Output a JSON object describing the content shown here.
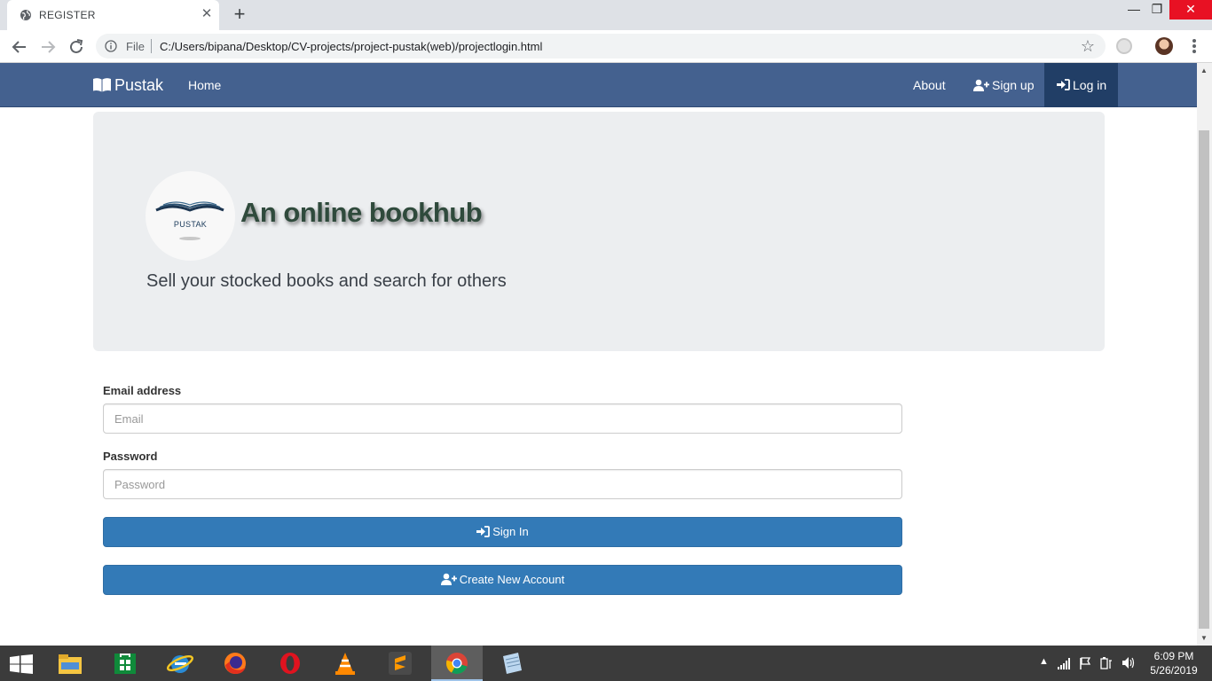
{
  "browser": {
    "tab_title": "REGISTER",
    "tab_close": "✕",
    "new_tab": "+",
    "scheme_label": "File",
    "url": "C:/Users/bipana/Desktop/CV-projects/project-pustak(web)/projectlogin.html",
    "window_minimize": "—",
    "window_maximize": "❐",
    "window_close": "✕",
    "bookmark_star": "☆"
  },
  "navbar": {
    "brand": "Pustak",
    "home": "Home",
    "about": "About",
    "signup": "Sign up",
    "login": "Log in",
    "background_color": "#44618f",
    "active_color": "#213e66"
  },
  "hero": {
    "logo_text": "PUSTAK",
    "title": "An online bookhub",
    "subtitle": "Sell your stocked books and search for others"
  },
  "form": {
    "email_label": "Email address",
    "email_placeholder": "Email",
    "email_value": "",
    "password_label": "Password",
    "password_placeholder": "Password",
    "password_value": "",
    "signin_label": "Sign In",
    "create_label": "Create New Account",
    "button_color": "#337ab7"
  },
  "taskbar": {
    "apps": [
      "file-explorer",
      "microsoft-store",
      "internet-explorer",
      "firefox",
      "opera",
      "vlc",
      "sublime-text",
      "chrome",
      "notepad"
    ],
    "active_app": "chrome",
    "time": "6:09 PM",
    "date": "5/26/2019"
  }
}
